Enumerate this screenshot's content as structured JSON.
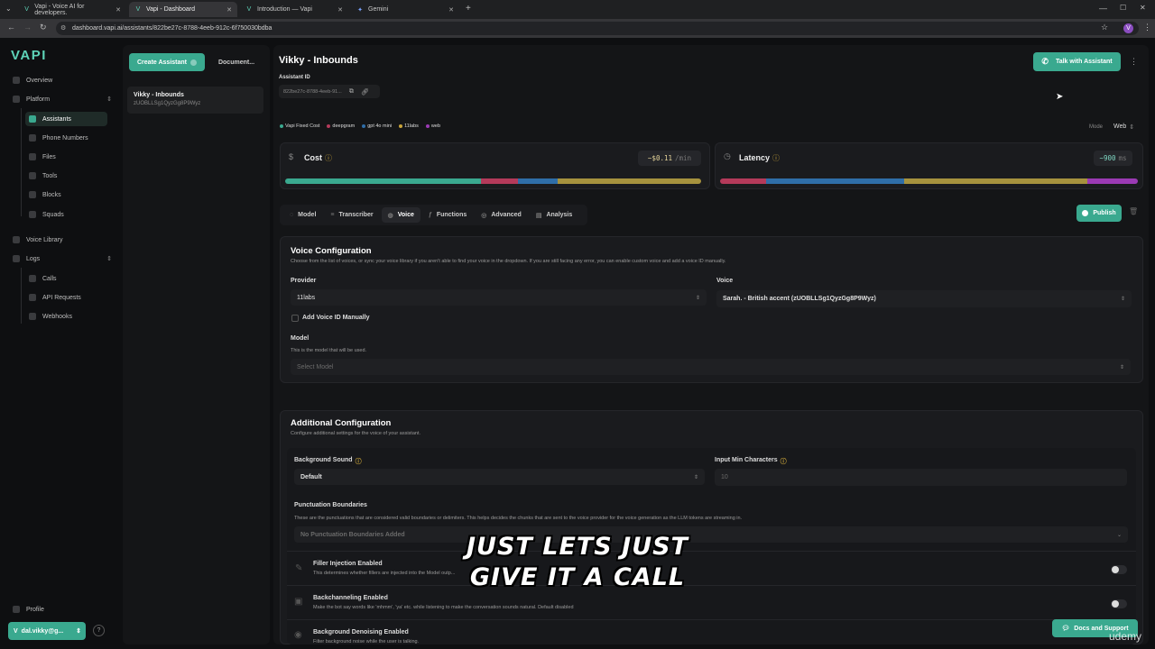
{
  "browser": {
    "tabs": [
      {
        "title": "Vapi - Voice AI for developers."
      },
      {
        "title": "Vapi - Dashboard"
      },
      {
        "title": "Introduction — Vapi"
      },
      {
        "title": "Gemini"
      }
    ],
    "url": "dashboard.vapi.ai/assistants/822be27c-8788-4eeb-912c-6f750030bdba",
    "profile_initial": "V"
  },
  "sidebar": {
    "logo": "VAPI",
    "overview": "Overview",
    "platform": "Platform",
    "platform_items": [
      "Assistants",
      "Phone Numbers",
      "Files",
      "Tools",
      "Blocks",
      "Squads"
    ],
    "voice_library": "Voice Library",
    "logs": "Logs",
    "logs_items": [
      "Calls",
      "API Requests",
      "Webhooks"
    ],
    "profile": "Profile",
    "account": "dal.vikky@g..."
  },
  "list": {
    "create_button": "Create Assistant",
    "docs_button": "Document...",
    "assistant_name": "Vikky - Inbounds",
    "assistant_sub": "zUOBLLSg1QyzGg8P9Wyz"
  },
  "header": {
    "title": "Vikky - Inbounds",
    "assistant_id_label": "Assistant ID",
    "assistant_id_value": "822be27c-8788-4eeb-91...",
    "talk_button": "Talk with Assistant",
    "mode_label": "Mode",
    "mode_value": "Web"
  },
  "legend": [
    {
      "label": "Vapi Fixed Cost",
      "color": "#3aa98f"
    },
    {
      "label": "deepgram",
      "color": "#b43a5a"
    },
    {
      "label": "gpt 4o mini",
      "color": "#2f6ea8"
    },
    {
      "label": "11labs",
      "color": "#c9a43a"
    },
    {
      "label": "web",
      "color": "#9b3ab4"
    }
  ],
  "cost": {
    "title": "Cost",
    "value": "~$0.11",
    "unit": "/min",
    "segments": [
      {
        "color": "#3aa98f",
        "share": 0.47
      },
      {
        "color": "#b43a5a",
        "share": 0.09
      },
      {
        "color": "#2f6ea8",
        "share": 0.095
      },
      {
        "color": "#a6923e",
        "share": 0.345
      }
    ]
  },
  "latency": {
    "title": "Latency",
    "value": "~900",
    "unit": "ms",
    "segments": [
      {
        "color": "#b43a5a",
        "share": 0.11
      },
      {
        "color": "#2f6ea8",
        "share": 0.33
      },
      {
        "color": "#a6923e",
        "share": 0.44
      },
      {
        "color": "#9b3ab4",
        "share": 0.12
      }
    ]
  },
  "tabs": [
    "Model",
    "Transcriber",
    "Voice",
    "Functions",
    "Advanced",
    "Analysis"
  ],
  "active_tab": "Voice",
  "publish_button": "Publish",
  "voice_config": {
    "title": "Voice Configuration",
    "desc": "Choose from the list of voices, or sync your voice library if you aren't able to find your voice in the dropdown. If you are still facing any error, you can enable custom voice and add a voice ID manually.",
    "provider_label": "Provider",
    "provider_value": "11labs",
    "voice_label": "Voice",
    "voice_value": "Sarah. - British accent (zUOBLLSg1QyzGg8P9Wyz)",
    "manual_checkbox": "Add Voice ID Manually",
    "model_label": "Model",
    "model_desc": "This is the model that will be used.",
    "model_placeholder": "Select Model"
  },
  "additional": {
    "title": "Additional Configuration",
    "desc": "Configure additional settings for the voice of your assistant.",
    "bg_sound_label": "Background Sound",
    "bg_sound_value": "Default",
    "min_chars_label": "Input Min Characters",
    "min_chars_value": "10",
    "punct_label": "Punctuation Boundaries",
    "punct_desc": "These are the punctuations that are considered valid boundaries or delimiters. This helps decides the chunks that are sent to the voice provider for the voice generation as the LLM tokens are streaming in.",
    "punct_value": "No Punctuation Boundaries Added",
    "filler_label": "Filler Injection Enabled",
    "filler_desc": "This determines whether fillers are injected into the Model outp...",
    "backchannel_label": "Backchanneling Enabled",
    "backchannel_desc": "Make the bot say words like 'mhmm', 'ya' etc. while listening to make the conversation sounds natural. Default disabled",
    "denoise_label": "Background Denoising Enabled",
    "denoise_desc": "Filter background noise while the user is talking."
  },
  "docs_button": "Docs and Support",
  "caption": [
    "JUST LETS JUST",
    "GIVE IT A CALL"
  ],
  "watermark": "udemy"
}
